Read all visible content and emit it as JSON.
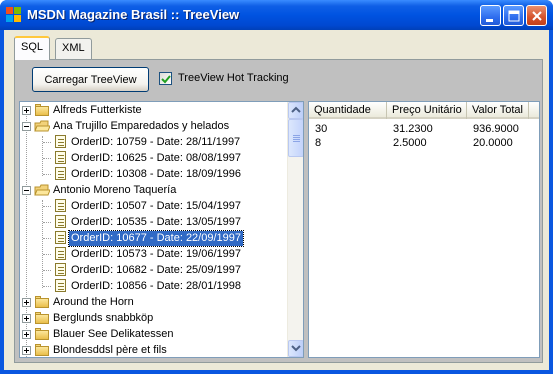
{
  "window": {
    "title": "MSDN Magazine Brasil :: TreeView"
  },
  "tabs": [
    {
      "label": "SQL",
      "active": true
    },
    {
      "label": "XML",
      "active": false
    }
  ],
  "toolbar": {
    "load_button_label": "Carregar TreeView",
    "hot_tracking_label": "TreeView Hot Tracking",
    "hot_tracking_checked": true
  },
  "tree": {
    "nodes": [
      {
        "label": "Alfreds Futterkiste",
        "type": "folder-closed",
        "expander": "plus"
      },
      {
        "label": "Ana Trujillo Emparedados y helados",
        "type": "folder-open",
        "expander": "minus"
      },
      {
        "label": "OrderID: 10759 - Date: 28/11/1997",
        "type": "order"
      },
      {
        "label": "OrderID: 10625 - Date: 08/08/1997",
        "type": "order"
      },
      {
        "label": "OrderID: 10308 - Date: 18/09/1996",
        "type": "order"
      },
      {
        "label": "Antonio Moreno Taquería",
        "type": "folder-open",
        "expander": "minus"
      },
      {
        "label": "OrderID: 10507 - Date: 15/04/1997",
        "type": "order"
      },
      {
        "label": "OrderID: 10535 - Date: 13/05/1997",
        "type": "order"
      },
      {
        "label": "OrderID: 10677 - Date: 22/09/1997",
        "type": "order",
        "selected": true
      },
      {
        "label": "OrderID: 10573 - Date: 19/06/1997",
        "type": "order"
      },
      {
        "label": "OrderID: 10682 - Date: 25/09/1997",
        "type": "order"
      },
      {
        "label": "OrderID: 10856 - Date: 28/01/1998",
        "type": "order"
      },
      {
        "label": "Around the Horn",
        "type": "folder-closed",
        "expander": "plus"
      },
      {
        "label": "Berglunds snabbköp",
        "type": "folder-closed",
        "expander": "plus"
      },
      {
        "label": "Blauer See Delikatessen",
        "type": "folder-closed",
        "expander": "plus"
      },
      {
        "label": "Blondesddsl père et fils",
        "type": "folder-closed",
        "expander": "plus"
      }
    ]
  },
  "details": {
    "columns": [
      "Quantidade",
      "Preço Unitário",
      "Valor Total"
    ],
    "rows": [
      [
        "30",
        "31.2300",
        "936.9000"
      ],
      [
        "8",
        "2.5000",
        "20.0000"
      ]
    ]
  },
  "colors": {
    "titlebar": "#0053E1",
    "selection": "#316AC5",
    "panel": "#C0C0C0",
    "client": "#ECE9D8"
  },
  "icons": {
    "folder_closed": "folder-icon",
    "folder_open": "open-folder-icon",
    "order": "document-icon",
    "minimize": "minimize-icon",
    "maximize": "maximize-icon",
    "close": "close-icon"
  }
}
